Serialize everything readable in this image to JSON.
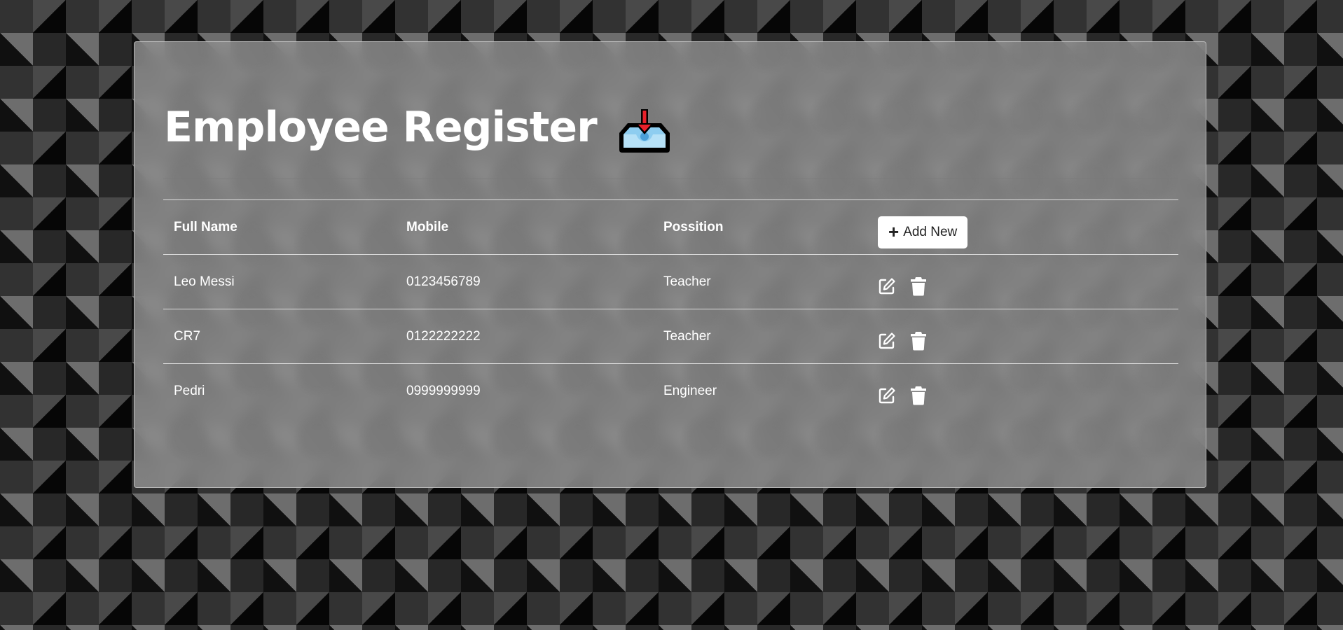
{
  "page": {
    "title": "Employee Register",
    "title_icon": "inbox-tray-icon"
  },
  "table": {
    "headers": {
      "full_name": "Full Name",
      "mobile": "Mobile",
      "position": "Possition"
    },
    "add_button": {
      "label": "Add New",
      "icon": "plus-icon"
    },
    "rows": [
      {
        "full_name": "Leo Messi",
        "mobile": "0123456789",
        "position": "Teacher"
      },
      {
        "full_name": "CR7",
        "mobile": "0122222222",
        "position": "Teacher"
      },
      {
        "full_name": "Pedri",
        "mobile": "0999999999",
        "position": "Engineer"
      }
    ],
    "row_actions": [
      "edit-icon",
      "trash-icon"
    ]
  },
  "colors": {
    "text": "#ffffff",
    "button_bg": "#ffffff",
    "button_text": "#222222"
  }
}
